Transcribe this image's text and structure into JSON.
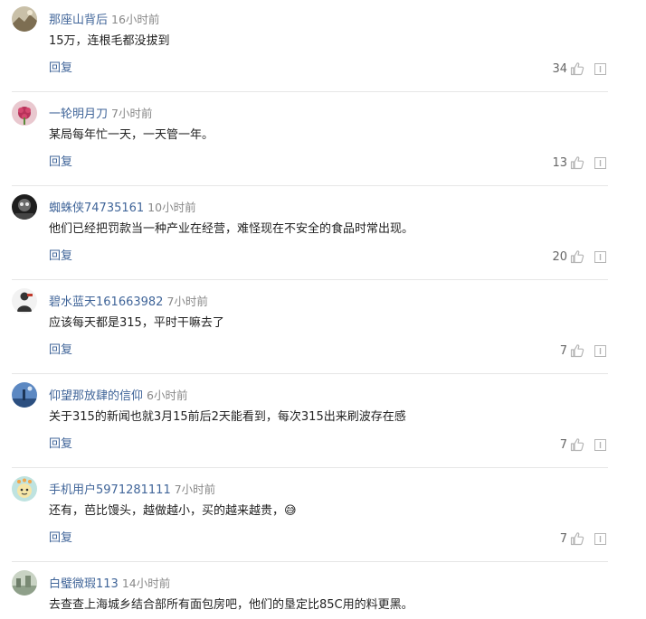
{
  "comments": [
    {
      "username": "那座山背后",
      "time": "16小时前",
      "content": "15万，连根毛都没拔到",
      "reply_label": "回复",
      "likes": "34",
      "avatar_icon": "landscape-avatar",
      "avatar_color": "#8a7a5c"
    },
    {
      "username": "一轮明月刀",
      "time": "7小时前",
      "content": "某局每年忙一天，一天管一年。",
      "reply_label": "回复",
      "likes": "13",
      "avatar_icon": "flower-avatar",
      "avatar_color": "#b8325a"
    },
    {
      "username": "蜘蛛侠74735161",
      "time": "10小时前",
      "content": "他们已经把罚款当一种产业在经营，难怪现在不安全的食品时常出现。",
      "reply_label": "回复",
      "likes": "20",
      "avatar_icon": "dark-photo-avatar",
      "avatar_color": "#2b2b2b"
    },
    {
      "username": "碧水蓝天161663982",
      "time": "7小时前",
      "content": "应该每天都是315，平时干嘛去了",
      "reply_label": "回复",
      "likes": "7",
      "avatar_icon": "figure-avatar",
      "avatar_color": "#3a3a3a"
    },
    {
      "username": "仰望那放肆的信仰",
      "time": "6小时前",
      "content": "关于315的新闻也就3月15前后2天能看到，每次315出来刷波存在感",
      "reply_label": "回复",
      "likes": "7",
      "avatar_icon": "sky-avatar",
      "avatar_color": "#3d6aa8"
    },
    {
      "username": "手机用户5971281111",
      "time": "7小时前",
      "content": "还有，芭比馒头，越做越小，买的越来越贵，😅",
      "reply_label": "回复",
      "likes": "7",
      "avatar_icon": "cartoon-avatar",
      "avatar_color": "#7fc4c0"
    },
    {
      "username": "白璧微瑕113",
      "time": "14小时前",
      "content": "去查查上海城乡结合部所有面包房吧，他们的垦定比85C用的料更黑。",
      "reply_label": "",
      "likes": "",
      "avatar_icon": "street-avatar",
      "avatar_color": "#8fa08a"
    }
  ],
  "colors": {
    "username": "#406599",
    "time": "#888888",
    "content": "#222222",
    "icon": "#b5b5b5",
    "divider": "#e6e6e6"
  }
}
